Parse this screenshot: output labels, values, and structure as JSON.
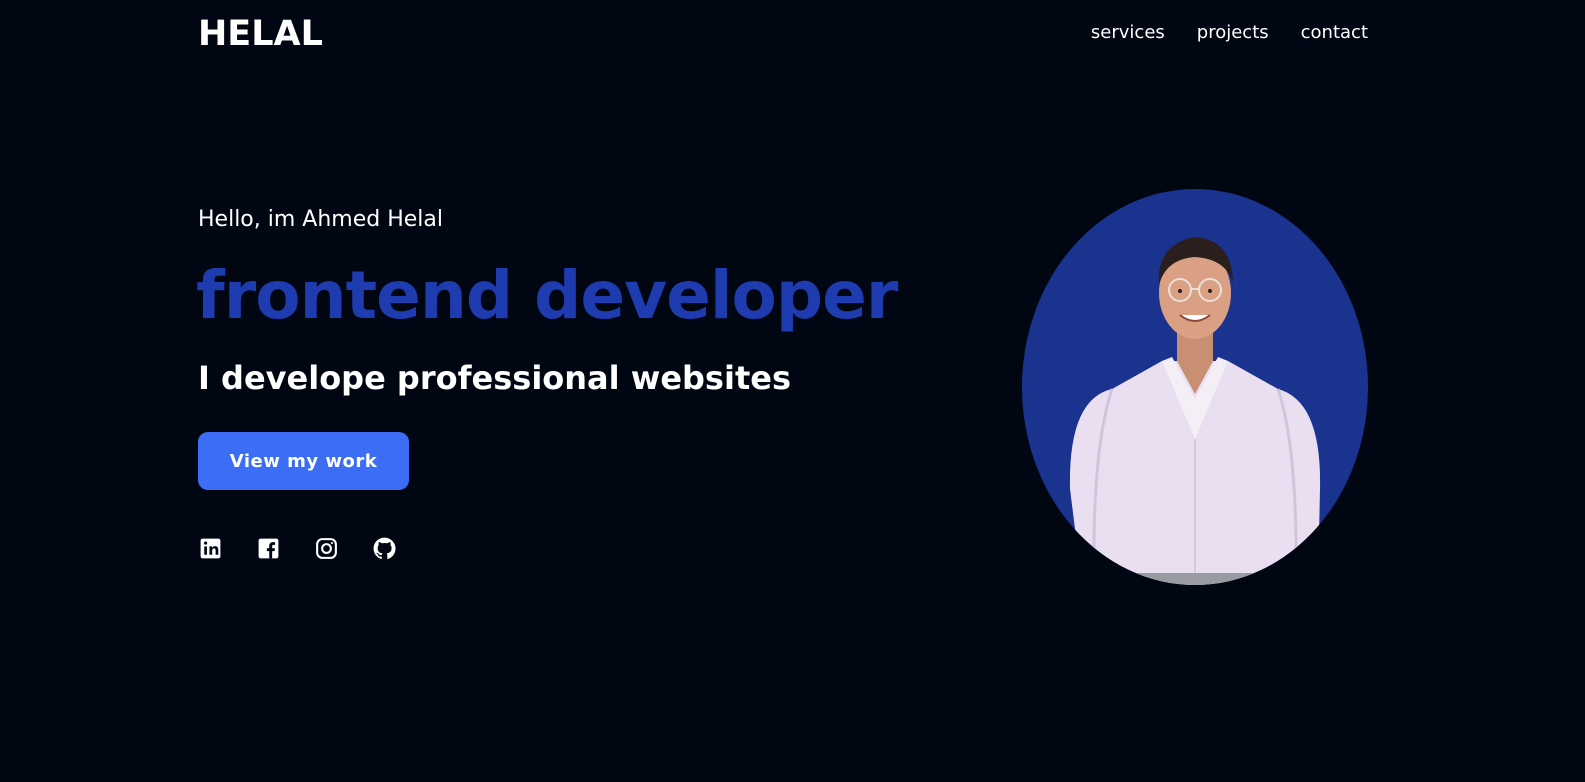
{
  "header": {
    "logo": "HELAL",
    "nav": [
      {
        "label": "services"
      },
      {
        "label": "projects"
      },
      {
        "label": "contact"
      }
    ]
  },
  "hero": {
    "greeting": "Hello, im Ahmed Helal",
    "role": "frontend developer",
    "tagline": "I develope professional websites",
    "cta_label": "View my work"
  },
  "socials": [
    {
      "icon": "linkedin-icon"
    },
    {
      "icon": "facebook-icon"
    },
    {
      "icon": "instagram-icon"
    },
    {
      "icon": "github-icon"
    }
  ],
  "colors": {
    "background": "#010613",
    "accent": "#1e3cb0",
    "button": "#3b6ef5",
    "portrait_bg": "#19338f"
  }
}
